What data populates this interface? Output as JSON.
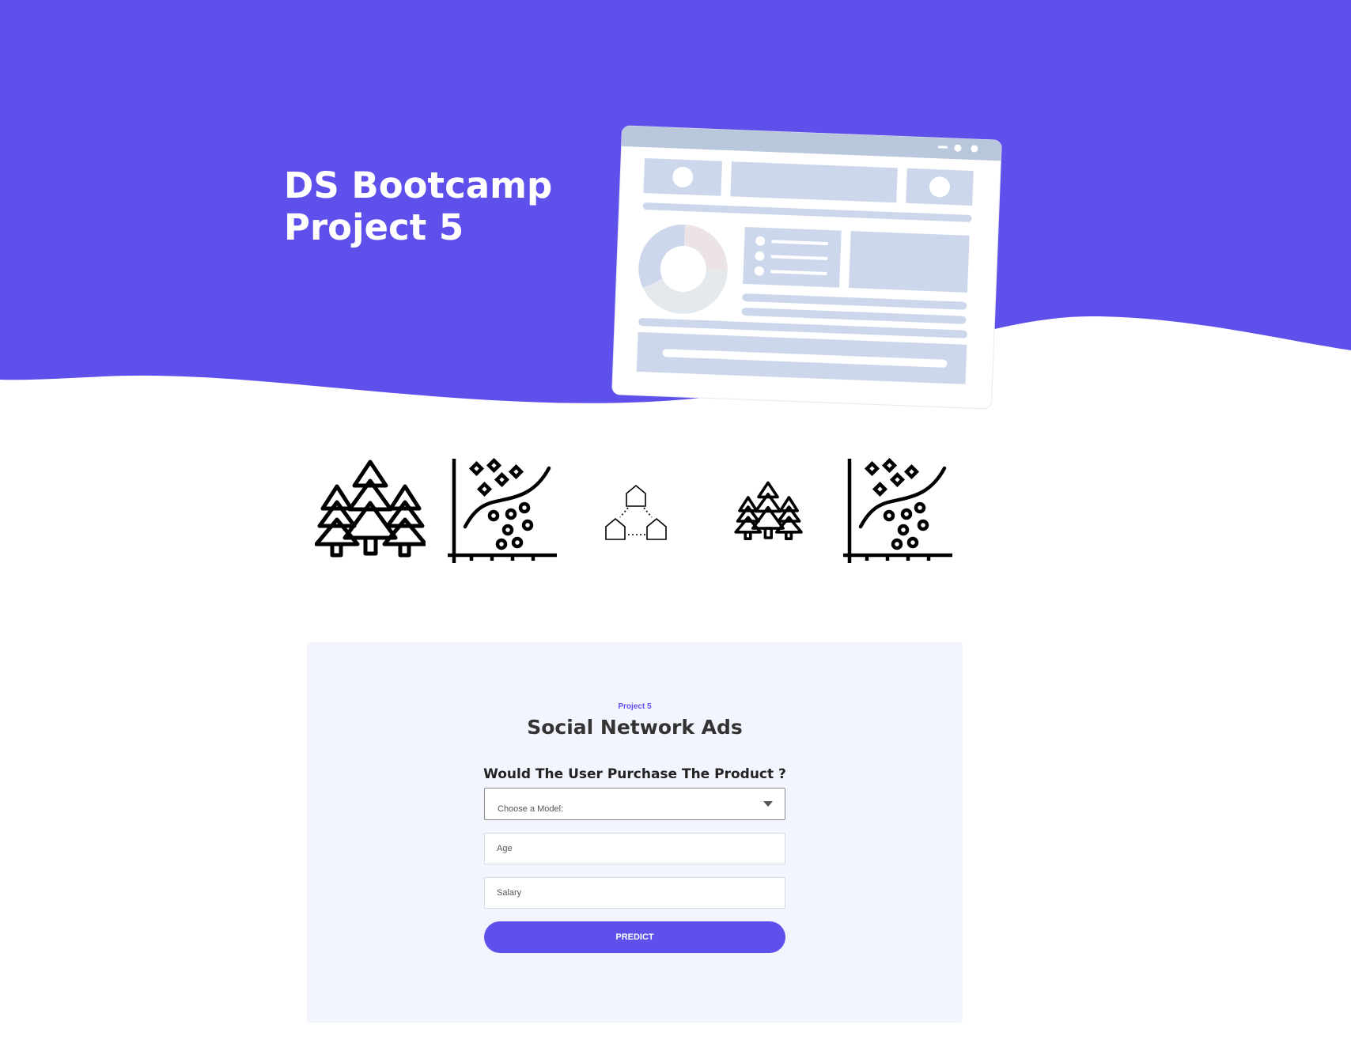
{
  "hero": {
    "title_line1": "DS Bootcamp",
    "title_line2": "Project 5"
  },
  "model_icons": [
    "decision-trees-icon",
    "classification-scatter-icon",
    "knn-graph-icon",
    "random-forest-icon",
    "classification-scatter-icon"
  ],
  "form": {
    "eyebrow": "Project 5",
    "title": "Social Network Ads",
    "question": "Would The User Purchase The Product ?",
    "model_select": {
      "selected": "Choose a Model:"
    },
    "age_placeholder": "Age",
    "salary_placeholder": "Salary",
    "submit_label": "PREDICT"
  },
  "colors": {
    "accent": "#5f50ec",
    "card_background": "#f2f5fd",
    "mockup_blue": "#ccd7eb"
  }
}
